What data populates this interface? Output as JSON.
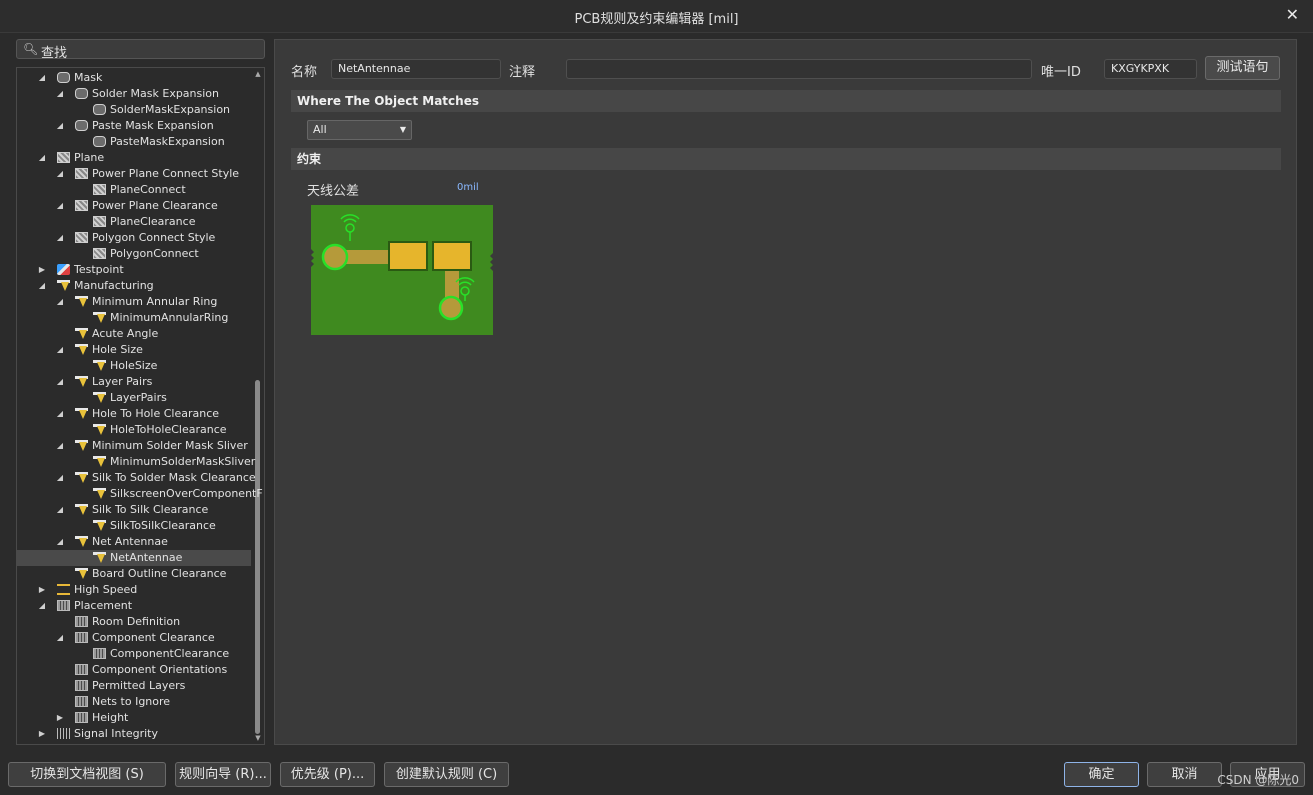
{
  "window": {
    "title": "PCB规则及约束编辑器 [mil]",
    "close": "✕"
  },
  "search": {
    "icon": "search-icon",
    "label": "查找"
  },
  "tree": {
    "rows": [
      {
        "label": "Mask",
        "depth": 1,
        "arrow": "◢",
        "icon": "mask"
      },
      {
        "label": "Solder Mask Expansion",
        "depth": 2,
        "arrow": "◢",
        "icon": "mask"
      },
      {
        "label": "SolderMaskExpansion",
        "depth": 3,
        "arrow": "",
        "icon": "mask"
      },
      {
        "label": "Paste Mask Expansion",
        "depth": 2,
        "arrow": "◢",
        "icon": "mask"
      },
      {
        "label": "PasteMaskExpansion",
        "depth": 3,
        "arrow": "",
        "icon": "mask"
      },
      {
        "label": "Plane",
        "depth": 1,
        "arrow": "◢",
        "icon": "plane"
      },
      {
        "label": "Power Plane Connect Style",
        "depth": 2,
        "arrow": "◢",
        "icon": "plane"
      },
      {
        "label": "PlaneConnect",
        "depth": 3,
        "arrow": "",
        "icon": "plane"
      },
      {
        "label": "Power Plane Clearance",
        "depth": 2,
        "arrow": "◢",
        "icon": "plane"
      },
      {
        "label": "PlaneClearance",
        "depth": 3,
        "arrow": "",
        "icon": "plane"
      },
      {
        "label": "Polygon Connect Style",
        "depth": 2,
        "arrow": "◢",
        "icon": "plane"
      },
      {
        "label": "PolygonConnect",
        "depth": 3,
        "arrow": "",
        "icon": "plane"
      },
      {
        "label": "Testpoint",
        "depth": 1,
        "arrow": "▶",
        "icon": "test"
      },
      {
        "label": "Manufacturing",
        "depth": 1,
        "arrow": "◢",
        "icon": "mfg"
      },
      {
        "label": "Minimum Annular Ring",
        "depth": 2,
        "arrow": "◢",
        "icon": "mfg"
      },
      {
        "label": "MinimumAnnularRing",
        "depth": 3,
        "arrow": "",
        "icon": "mfg"
      },
      {
        "label": "Acute Angle",
        "depth": 2,
        "arrow": "",
        "icon": "mfg"
      },
      {
        "label": "Hole Size",
        "depth": 2,
        "arrow": "◢",
        "icon": "mfg"
      },
      {
        "label": "HoleSize",
        "depth": 3,
        "arrow": "",
        "icon": "mfg"
      },
      {
        "label": "Layer Pairs",
        "depth": 2,
        "arrow": "◢",
        "icon": "mfg"
      },
      {
        "label": "LayerPairs",
        "depth": 3,
        "arrow": "",
        "icon": "mfg"
      },
      {
        "label": "Hole To Hole Clearance",
        "depth": 2,
        "arrow": "◢",
        "icon": "mfg"
      },
      {
        "label": "HoleToHoleClearance",
        "depth": 3,
        "arrow": "",
        "icon": "mfg"
      },
      {
        "label": "Minimum Solder Mask Sliver",
        "depth": 2,
        "arrow": "◢",
        "icon": "mfg"
      },
      {
        "label": "MinimumSolderMaskSliver",
        "depth": 3,
        "arrow": "",
        "icon": "mfg"
      },
      {
        "label": "Silk To Solder Mask Clearance",
        "depth": 2,
        "arrow": "◢",
        "icon": "mfg"
      },
      {
        "label": "SilkscreenOverComponentF",
        "depth": 3,
        "arrow": "",
        "icon": "mfg"
      },
      {
        "label": "Silk To Silk Clearance",
        "depth": 2,
        "arrow": "◢",
        "icon": "mfg"
      },
      {
        "label": "SilkToSilkClearance",
        "depth": 3,
        "arrow": "",
        "icon": "mfg"
      },
      {
        "label": "Net Antennae",
        "depth": 2,
        "arrow": "◢",
        "icon": "mfg"
      },
      {
        "label": "NetAntennae",
        "depth": 3,
        "arrow": "",
        "icon": "mfg",
        "selected": true
      },
      {
        "label": "Board Outline Clearance",
        "depth": 2,
        "arrow": "",
        "icon": "mfg"
      },
      {
        "label": "High Speed",
        "depth": 1,
        "arrow": "▶",
        "icon": "hs"
      },
      {
        "label": "Placement",
        "depth": 1,
        "arrow": "◢",
        "icon": "place"
      },
      {
        "label": "Room Definition",
        "depth": 2,
        "arrow": "",
        "icon": "place"
      },
      {
        "label": "Component Clearance",
        "depth": 2,
        "arrow": "◢",
        "icon": "place"
      },
      {
        "label": "ComponentClearance",
        "depth": 3,
        "arrow": "",
        "icon": "place"
      },
      {
        "label": "Component Orientations",
        "depth": 2,
        "arrow": "",
        "icon": "place"
      },
      {
        "label": "Permitted Layers",
        "depth": 2,
        "arrow": "",
        "icon": "place"
      },
      {
        "label": "Nets to Ignore",
        "depth": 2,
        "arrow": "",
        "icon": "place"
      },
      {
        "label": "Height",
        "depth": 2,
        "arrow": "▶",
        "icon": "place"
      },
      {
        "label": "Signal Integrity",
        "depth": 1,
        "arrow": "▶",
        "icon": "si"
      }
    ]
  },
  "rule": {
    "name_label": "名称",
    "name_value": "NetAntennae",
    "comment_label": "注释",
    "comment_value": "",
    "uid_label": "唯一ID",
    "uid_value": "KXGYKPXK",
    "test_button": "测试语句",
    "where_title": "Where The Object Matches",
    "match_select": "All",
    "constraints_title": "约束",
    "antenna_label": "天线公差",
    "antenna_value": "0mil"
  },
  "footer": {
    "doc_view": "切换到文档视图 (S)",
    "rule_wizard": "规则向导 (R)...",
    "priorities": "优先级 (P)...",
    "create_default": "创建默认规则 (C)",
    "ok": "确定",
    "cancel": "取消",
    "apply": "应用",
    "watermark": "CSDN @陈光0"
  },
  "colors": {
    "board": "#3f8a1f",
    "copper": "#e6b52c",
    "trace": "#b59a3a",
    "marker": "#28e028"
  }
}
